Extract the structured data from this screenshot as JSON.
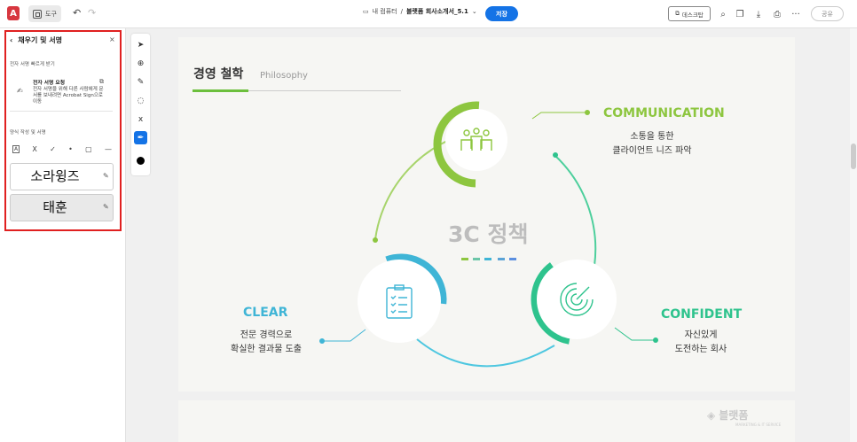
{
  "toolbar": {
    "logo": "A",
    "tool_label": "도구",
    "undo": "↶",
    "redo": "↷",
    "breadcrumb_location": "내 컴퓨터",
    "separator": "/",
    "file_name": "블랫폼 회사소개서_5.1",
    "save_label": "저장",
    "desktop_label": "데스크탑",
    "share_label": "공유",
    "more": "···"
  },
  "left_panel": {
    "title": "채우기 및 서명",
    "close": "×",
    "quick_label": "전자 서명 빠르게 받기",
    "request_title": "전자 서명 요청",
    "request_desc": "전자 서명을 위해 다른 사람에게 문서를 보내려면 Acrobat Sign으로 이동",
    "self_label": "양식 작성 및 서명",
    "tools": [
      "A",
      "X",
      "✓",
      "•",
      "▢",
      "—"
    ],
    "signatures": [
      "소라윙즈",
      "태훈"
    ]
  },
  "doc": {
    "title": "경영 철학",
    "subtitle": "Philosophy",
    "center_text": "3C 정책",
    "communication": {
      "label": "COMMUNICATION",
      "desc1": "소통을 통한",
      "desc2": "클라이언트 니즈 파악",
      "color": "#8dc63f"
    },
    "clear": {
      "label": "CLEAR",
      "desc1": "전문 경력으로",
      "desc2": "확실한 결과물 도출",
      "color": "#3fb5d6"
    },
    "confident": {
      "label": "CONFIDENT",
      "desc1": "자신있게",
      "desc2": "도전하는 회사",
      "color": "#2ec38d"
    },
    "watermark": "블랫폼",
    "watermark_sub": "MARKETING & IT SERVICE"
  }
}
